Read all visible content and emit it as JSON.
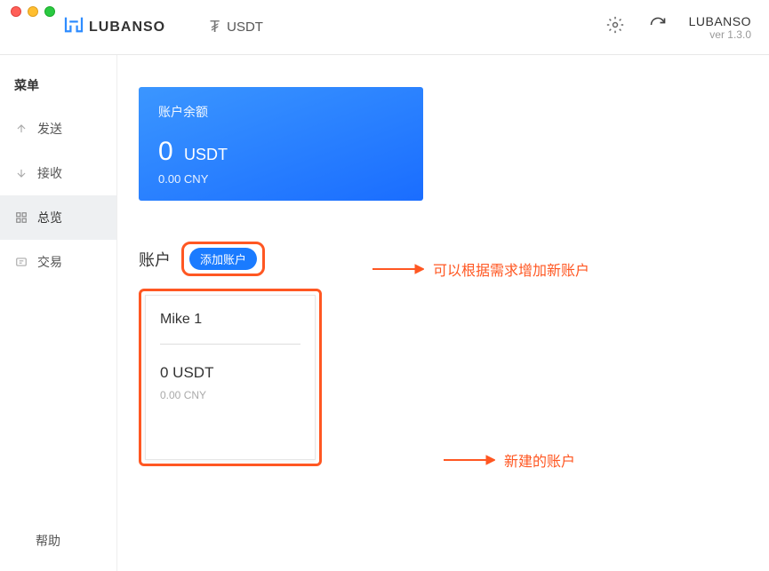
{
  "app": {
    "logo_text": "LUBANSO",
    "currency_symbol": "₮",
    "currency_label": "USDT",
    "brand_name": "LUBANSO",
    "version": "ver 1.3.0"
  },
  "sidebar": {
    "menu_title": "菜单",
    "items": [
      {
        "label": "发送"
      },
      {
        "label": "接收"
      },
      {
        "label": "总览"
      },
      {
        "label": "交易"
      }
    ],
    "help": "帮助"
  },
  "balance": {
    "label": "账户余额",
    "amount": "0",
    "unit": "USDT",
    "cny": "0.00 CNY"
  },
  "accounts": {
    "section_label": "账户",
    "add_button": "添加账户",
    "cards": [
      {
        "name": "Mike 1",
        "balance": "0 USDT",
        "cny": "0.00 CNY"
      }
    ]
  },
  "annotations": {
    "add_hint": "可以根据需求增加新账户",
    "card_hint": "新建的账户"
  }
}
